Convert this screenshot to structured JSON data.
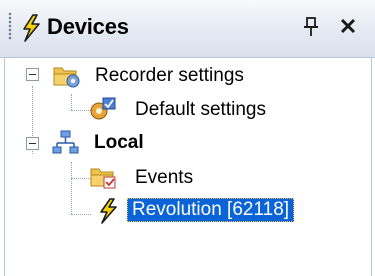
{
  "panel": {
    "title": "Devices",
    "pin_glyph": "⌂",
    "close_glyph": "×",
    "title_icon": "lightning-icon",
    "pin_icon": "pin-icon",
    "close_icon": "close-icon"
  },
  "tree": {
    "recorder_settings": {
      "label": "Recorder settings",
      "icon": "folder-gear-icon",
      "expanded": true
    },
    "default_settings": {
      "label": "Default settings",
      "icon": "settings-gear-icon"
    },
    "local": {
      "label": "Local",
      "icon": "network-icon",
      "expanded": true
    },
    "events": {
      "label": "Events",
      "icon": "folder-events-icon"
    },
    "revolution": {
      "label": "Revolution [62118]",
      "icon": "lightning-icon",
      "selected": true
    }
  },
  "colors": {
    "selection": "#0a64d8",
    "header_gradient_top": "#f7f9fc",
    "header_gradient_bottom": "#d8e0ec",
    "folder": "#f0c24b",
    "lightning": "#f5d20a"
  }
}
